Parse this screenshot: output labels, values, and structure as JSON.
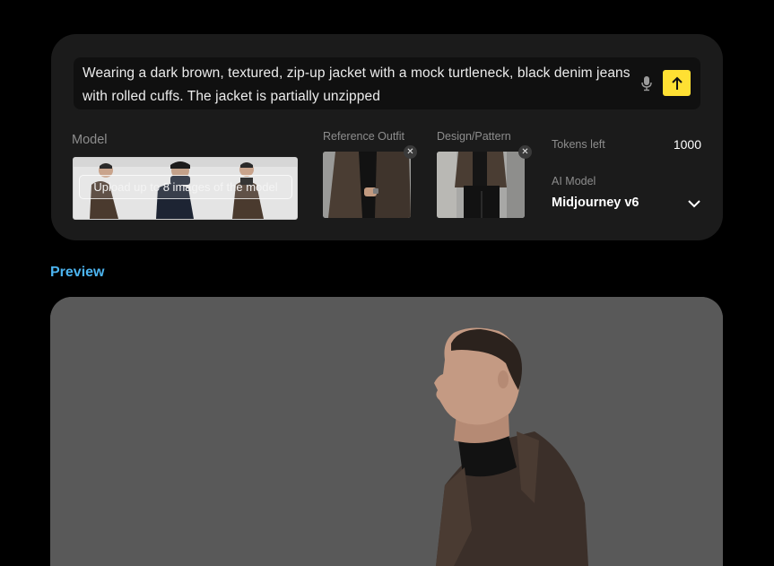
{
  "prompt": {
    "text": "Wearing a dark brown, textured, zip-up jacket with a mock turtleneck, black denim jeans with rolled cuffs. The jacket is partially unzipped",
    "mic_icon": "mic-icon",
    "send_icon": "arrow-up-icon"
  },
  "model": {
    "label": "Model",
    "upload_label": "Upload up to 8 images of the model"
  },
  "reference_outfit": {
    "label": "Reference Outfit",
    "remove_glyph": "✕"
  },
  "design_pattern": {
    "label": "Design/Pattern",
    "remove_glyph": "✕"
  },
  "tokens": {
    "label": "Tokens left",
    "value": "1000"
  },
  "ai_model": {
    "label": "AI Model",
    "value": "Midjourney v6"
  },
  "preview": {
    "title": "Preview"
  },
  "colors": {
    "accent_yellow": "#ffe033",
    "preview_blue": "#4cb4f0",
    "panel_bg": "#1b1b1b",
    "preview_bg": "#595959"
  }
}
